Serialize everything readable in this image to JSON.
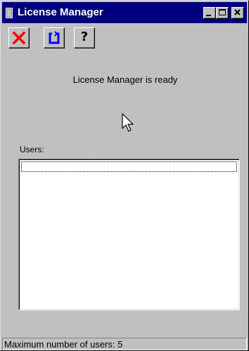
{
  "window": {
    "title": "License Manager",
    "colors": {
      "titlebar": "#000080",
      "face": "#c0c0c0",
      "exit_icon": "#ff0000",
      "refresh_icon": "#0000ff"
    }
  },
  "toolbar": {
    "buttons": [
      {
        "icon": "exit-icon"
      },
      {
        "icon": "refresh-icon"
      },
      {
        "icon": "help-icon",
        "glyph": "?"
      }
    ]
  },
  "main": {
    "message": "License Manager is ready",
    "users_label": "Users:",
    "users": []
  },
  "statusbar": {
    "text": "Maximum number of users: 5"
  }
}
